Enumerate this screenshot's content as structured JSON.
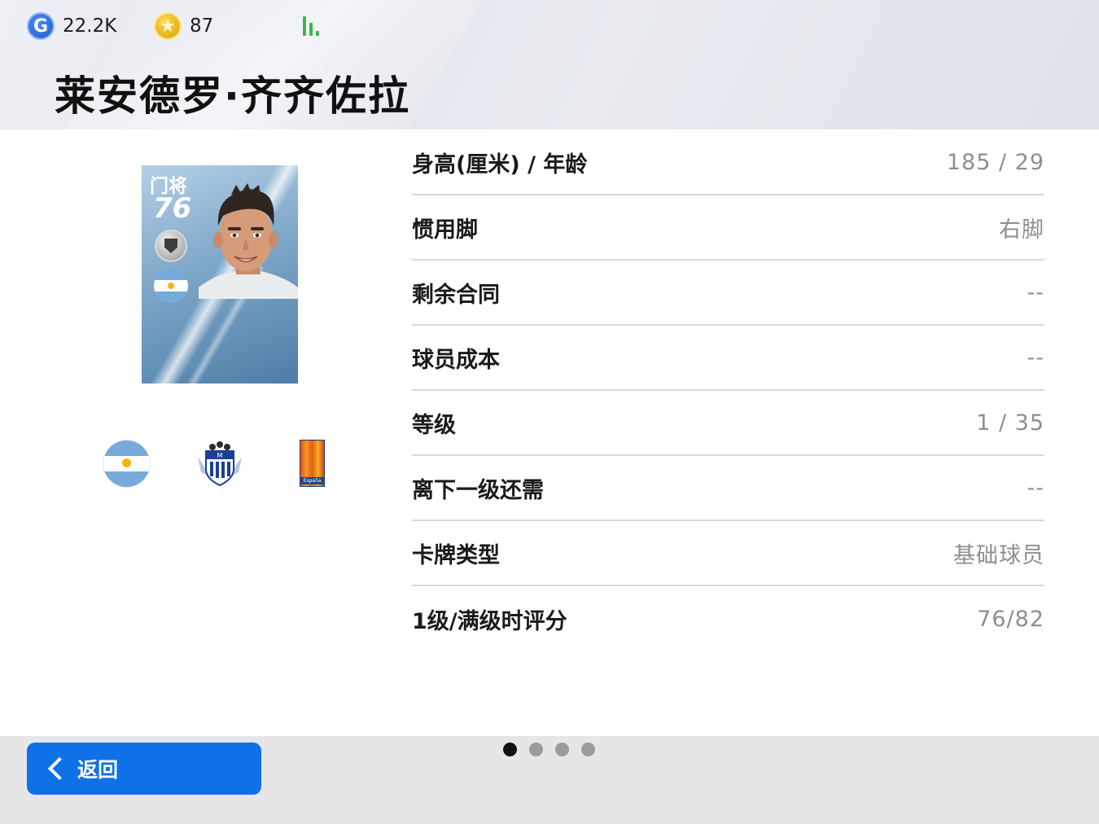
{
  "header": {
    "gp": {
      "icon": "gp-coin-icon",
      "value": "22.2K"
    },
    "coins": {
      "icon": "star-coin-icon",
      "value": "87"
    },
    "signal_icon": "signal-bars-icon",
    "player_name": "莱安德罗·齐齐佐拉"
  },
  "card": {
    "position": "门将",
    "rating": "76",
    "medal_icon": "silver-shield-medal-icon",
    "nationality_flag": "argentina-flag-icon",
    "photo": "player-portrait"
  },
  "badges": {
    "nation": "argentina-flag-icon",
    "club": "club-crest-icon",
    "league": {
      "icon": "league-badge-icon",
      "text": "España"
    }
  },
  "stats": [
    {
      "label": "身高(厘米) / 年龄",
      "value": "185 / 29"
    },
    {
      "label": "惯用脚",
      "value": "右脚"
    },
    {
      "label": "剩余合同",
      "value": "--"
    },
    {
      "label": "球员成本",
      "value": "--"
    },
    {
      "label": "等级",
      "value": "1 / 35"
    },
    {
      "label": "离下一级还需",
      "value": "--"
    },
    {
      "label": "卡牌类型",
      "value": "基础球员"
    },
    {
      "label": "1级/满级时评分",
      "value": "76/82"
    }
  ],
  "footer": {
    "back_label": "返回",
    "page_count": 4,
    "active_page": 1
  },
  "colors": {
    "accent": "#0f71e8",
    "header_bg": "#e6e8ee",
    "card_blue": "#6f9cc2",
    "stat_value": "#8e8e8e"
  }
}
